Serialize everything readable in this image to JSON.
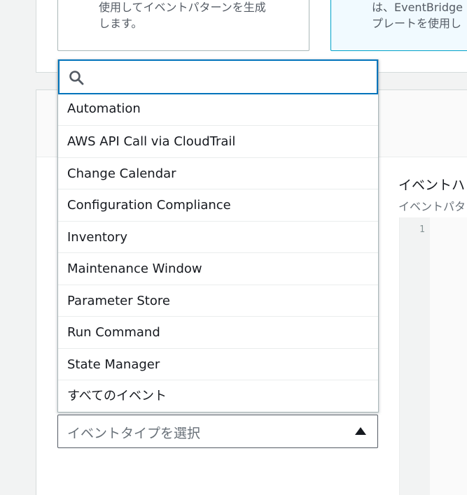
{
  "top_options": {
    "left_card": {
      "line1": "使用してイベントパターンを生成",
      "line2": "します。"
    },
    "right_card": {
      "line1": "は、EventBridge",
      "line2": "プレートを使用し"
    }
  },
  "event_pattern": {
    "title": "イベントハ",
    "description": "イベントパタ",
    "line_number": "1"
  },
  "dropdown": {
    "search_placeholder": "",
    "items": [
      "Automation",
      "AWS API Call via CloudTrail",
      "Change Calendar",
      "Configuration Compliance",
      "Inventory",
      "Maintenance Window",
      "Parameter Store",
      "Run Command",
      "State Manager",
      "すべてのイベント"
    ]
  },
  "event_type_select": {
    "placeholder": "イベントタイプを選択"
  },
  "colors": {
    "focus_border": "#0073bb",
    "selected_card_bg": "#f1faff",
    "text": "#16191f",
    "muted": "#687078"
  }
}
